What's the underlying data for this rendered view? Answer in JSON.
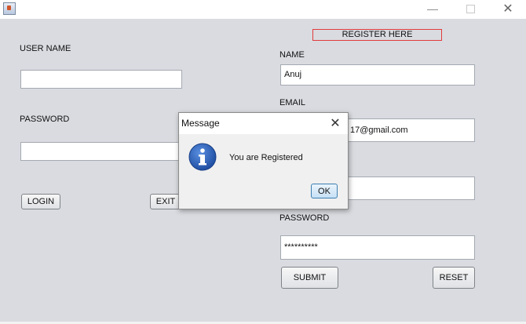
{
  "window": {
    "title": "",
    "minimize_glyph": "—",
    "close_glyph": "✕"
  },
  "login": {
    "username_label": "USER NAME",
    "username_value": "",
    "password_label": "PASSWORD",
    "password_value": "",
    "login_button": "LOGIN",
    "exit_button": "EXIT"
  },
  "register": {
    "heading": "REGISTER HERE",
    "name_label": "NAME",
    "name_value": "Anuj",
    "email_label": "EMAIL",
    "email_value": "17@gmail.com",
    "phone_value": "",
    "password_label": "PASSWORD",
    "password_value": "**********",
    "submit_button": "SUBMIT",
    "reset_button": "RESET"
  },
  "dialog": {
    "title": "Message",
    "message": "You are Registered",
    "ok_button": "OK",
    "close_glyph": "✕",
    "icon": "info-icon"
  },
  "colors": {
    "background": "#d9dbe0",
    "register_border": "#e23b3b",
    "info_icon": "#2b62b8"
  }
}
